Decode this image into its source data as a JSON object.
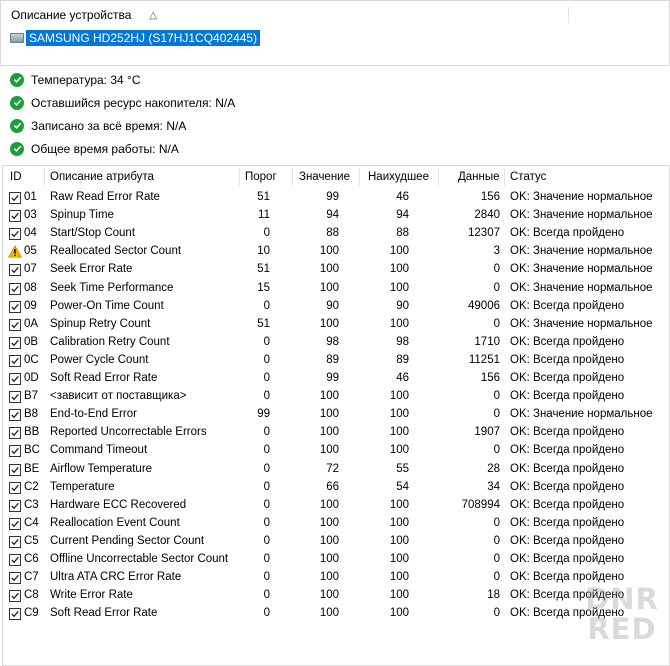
{
  "device_panel": {
    "column_title": "Описание устройства",
    "sort_indicator": "△",
    "selected_device": "SAMSUNG HD252HJ (S17HJ1CQ402445)"
  },
  "summary": [
    {
      "text": "Температура: 34 °C"
    },
    {
      "text": "Оставшийся ресурс накопителя: N/A"
    },
    {
      "text": "Записано за всё время: N/A"
    },
    {
      "text": "Общее время работы: N/A"
    }
  ],
  "table": {
    "headers": {
      "id": "ID",
      "name": "Описание атрибута",
      "threshold": "Порог",
      "value": "Значение",
      "worst": "Наихудшее",
      "data": "Данные",
      "status": "Статус"
    },
    "rows": [
      {
        "icon": "check",
        "id": "01",
        "name": "Raw Read Error Rate",
        "threshold": "51",
        "value": "99",
        "worst": "46",
        "data": "156",
        "status": "OK: Значение нормальное"
      },
      {
        "icon": "check",
        "id": "03",
        "name": "Spinup Time",
        "threshold": "11",
        "value": "94",
        "worst": "94",
        "data": "2840",
        "status": "OK: Значение нормальное"
      },
      {
        "icon": "check",
        "id": "04",
        "name": "Start/Stop Count",
        "threshold": "0",
        "value": "88",
        "worst": "88",
        "data": "12307",
        "status": "OK: Всегда пройдено"
      },
      {
        "icon": "warning",
        "id": "05",
        "name": "Reallocated Sector Count",
        "threshold": "10",
        "value": "100",
        "worst": "100",
        "data": "3",
        "status": "OK: Значение нормальное"
      },
      {
        "icon": "check",
        "id": "07",
        "name": "Seek Error Rate",
        "threshold": "51",
        "value": "100",
        "worst": "100",
        "data": "0",
        "status": "OK: Значение нормальное"
      },
      {
        "icon": "check",
        "id": "08",
        "name": "Seek Time Performance",
        "threshold": "15",
        "value": "100",
        "worst": "100",
        "data": "0",
        "status": "OK: Значение нормальное"
      },
      {
        "icon": "check",
        "id": "09",
        "name": "Power-On Time Count",
        "threshold": "0",
        "value": "90",
        "worst": "90",
        "data": "49006",
        "status": "OK: Всегда пройдено"
      },
      {
        "icon": "check",
        "id": "0A",
        "name": "Spinup Retry Count",
        "threshold": "51",
        "value": "100",
        "worst": "100",
        "data": "0",
        "status": "OK: Значение нормальное"
      },
      {
        "icon": "check",
        "id": "0B",
        "name": "Calibration Retry Count",
        "threshold": "0",
        "value": "98",
        "worst": "98",
        "data": "1710",
        "status": "OK: Всегда пройдено"
      },
      {
        "icon": "check",
        "id": "0C",
        "name": "Power Cycle Count",
        "threshold": "0",
        "value": "89",
        "worst": "89",
        "data": "11251",
        "status": "OK: Всегда пройдено"
      },
      {
        "icon": "check",
        "id": "0D",
        "name": "Soft Read Error Rate",
        "threshold": "0",
        "value": "99",
        "worst": "46",
        "data": "156",
        "status": "OK: Всегда пройдено"
      },
      {
        "icon": "check",
        "id": "B7",
        "name": "<зависит от поставщика>",
        "threshold": "0",
        "value": "100",
        "worst": "100",
        "data": "0",
        "status": "OK: Всегда пройдено"
      },
      {
        "icon": "check",
        "id": "B8",
        "name": "End-to-End Error",
        "threshold": "99",
        "value": "100",
        "worst": "100",
        "data": "0",
        "status": "OK: Значение нормальное"
      },
      {
        "icon": "check",
        "id": "BB",
        "name": "Reported Uncorrectable Errors",
        "threshold": "0",
        "value": "100",
        "worst": "100",
        "data": "1907",
        "status": "OK: Всегда пройдено"
      },
      {
        "icon": "check",
        "id": "BC",
        "name": "Command Timeout",
        "threshold": "0",
        "value": "100",
        "worst": "100",
        "data": "0",
        "status": "OK: Всегда пройдено"
      },
      {
        "icon": "check",
        "id": "BE",
        "name": "Airflow Temperature",
        "threshold": "0",
        "value": "72",
        "worst": "55",
        "data": "28",
        "status": "OK: Всегда пройдено"
      },
      {
        "icon": "check",
        "id": "C2",
        "name": "Temperature",
        "threshold": "0",
        "value": "66",
        "worst": "54",
        "data": "34",
        "status": "OK: Всегда пройдено"
      },
      {
        "icon": "check",
        "id": "C3",
        "name": "Hardware ECC Recovered",
        "threshold": "0",
        "value": "100",
        "worst": "100",
        "data": "708994",
        "status": "OK: Всегда пройдено"
      },
      {
        "icon": "check",
        "id": "C4",
        "name": "Reallocation Event Count",
        "threshold": "0",
        "value": "100",
        "worst": "100",
        "data": "0",
        "status": "OK: Всегда пройдено"
      },
      {
        "icon": "check",
        "id": "C5",
        "name": "Current Pending Sector Count",
        "threshold": "0",
        "value": "100",
        "worst": "100",
        "data": "0",
        "status": "OK: Всегда пройдено"
      },
      {
        "icon": "check",
        "id": "C6",
        "name": "Offline Uncorrectable Sector Count",
        "threshold": "0",
        "value": "100",
        "worst": "100",
        "data": "0",
        "status": "OK: Всегда пройдено"
      },
      {
        "icon": "check",
        "id": "C7",
        "name": "Ultra ATA CRC Error Rate",
        "threshold": "0",
        "value": "100",
        "worst": "100",
        "data": "0",
        "status": "OK: Всегда пройдено"
      },
      {
        "icon": "check",
        "id": "C8",
        "name": "Write Error Rate",
        "threshold": "0",
        "value": "100",
        "worst": "100",
        "data": "18",
        "status": "OK: Всегда пройдено"
      },
      {
        "icon": "check",
        "id": "C9",
        "name": "Soft Read Error Rate",
        "threshold": "0",
        "value": "100",
        "worst": "100",
        "data": "0",
        "status": "OK: Всегда пройдено"
      }
    ]
  },
  "watermark": {
    "line1": "DNR",
    "line2": "RED"
  },
  "colors": {
    "selection": "#0078d7",
    "ok_green": "#1e9e3a",
    "warning": "#f2b600"
  }
}
